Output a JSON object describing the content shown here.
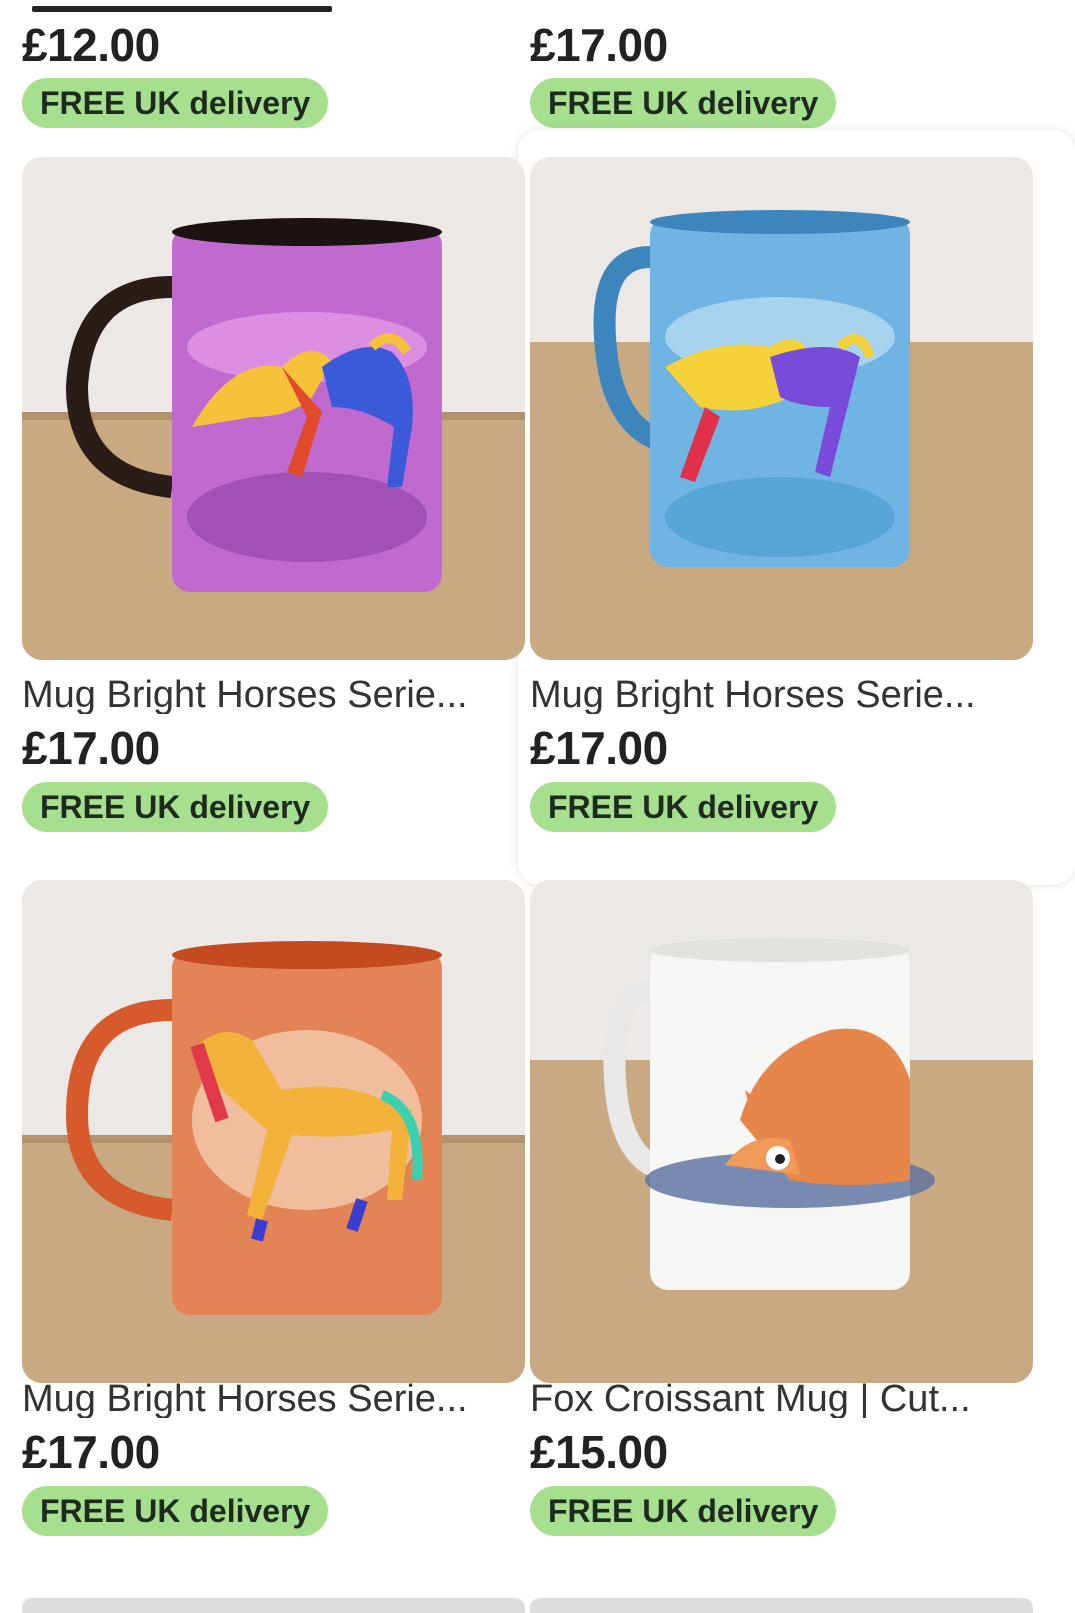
{
  "top_row": [
    {
      "price": "£12.00",
      "delivery": "FREE UK delivery"
    },
    {
      "price": "£17.00",
      "delivery": "FREE UK delivery"
    }
  ],
  "products": [
    {
      "title": "Mug Bright Horses Serie...",
      "price": "£17.00",
      "delivery": "FREE UK delivery",
      "image": "purple-horses-mug"
    },
    {
      "title": "Mug Bright Horses Serie...",
      "price": "£17.00",
      "delivery": "FREE UK delivery",
      "image": "blue-horses-mug"
    },
    {
      "title": "Mug Bright Horses Serie...",
      "price": "£17.00",
      "delivery": "FREE UK delivery",
      "image": "orange-horse-mug"
    },
    {
      "title": "Fox Croissant Mug | Cut...",
      "price": "£15.00",
      "delivery": "FREE UK delivery",
      "image": "fox-mug"
    }
  ],
  "colors": {
    "badge_bg": "#a6e08f",
    "price_text": "#222222",
    "title_text": "#333333"
  }
}
